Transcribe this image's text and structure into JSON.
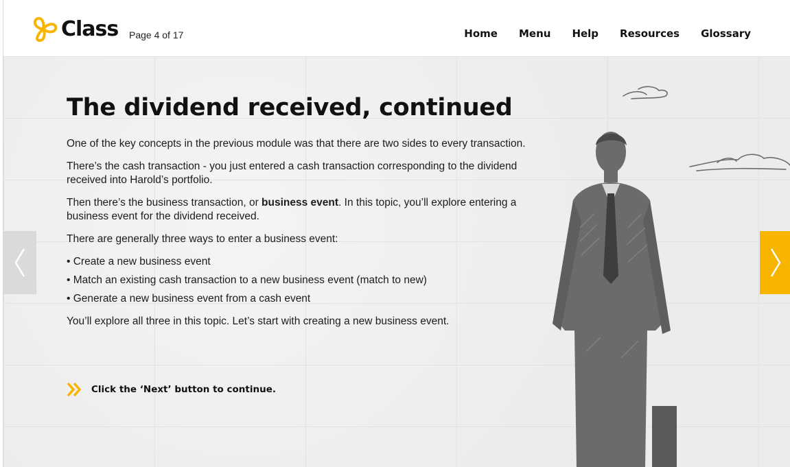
{
  "header": {
    "brand": "Class",
    "page_indicator": "Page 4 of 17",
    "nav": [
      "Home",
      "Menu",
      "Help",
      "Resources",
      "Glossary"
    ]
  },
  "main": {
    "title": "The dividend received, continued",
    "paragraph1": "One of the key concepts in the previous module was that there are two sides to every transaction.",
    "paragraph2": "There’s the cash transaction - you just entered a cash transaction corresponding to the dividend received into Harold’s portfolio.",
    "paragraph3_before": "Then there’s the business transaction, or ",
    "paragraph3_bold": "business event",
    "paragraph3_after": ". In this topic, you’ll explore entering a business event for the dividend received.",
    "paragraph4": "There are generally three ways to enter a business event:",
    "bullets": [
      "Create a new business event",
      "Match an existing cash transaction to a new business event (match to new)",
      "Generate a new business event from a cash event"
    ],
    "paragraph5": "You’ll explore all three in this topic. Let’s start with creating a new business event.",
    "cta": "Click the ‘Next’ button to continue."
  },
  "icons": {
    "logo": "clover-logo-icon",
    "cta": "double-chevron-right-icon",
    "prev": "chevron-left-icon",
    "next": "chevron-right-icon"
  },
  "colors": {
    "accent": "#f7b500",
    "prev_bg": "#dadada",
    "sketch": "#6b6b6b"
  }
}
